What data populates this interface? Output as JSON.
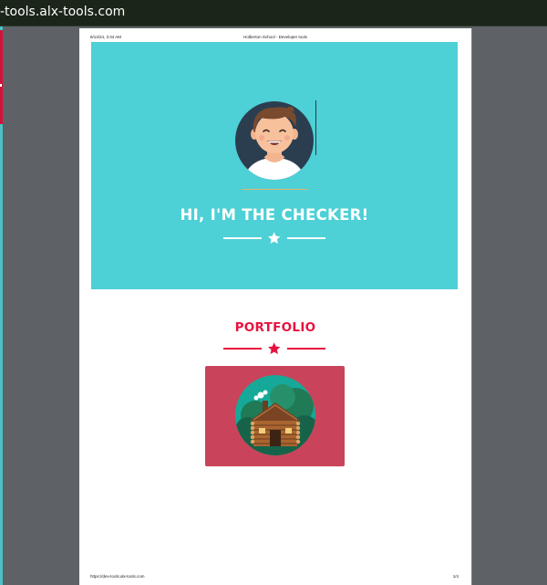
{
  "window": {
    "title": "-tools.alx-tools.com"
  },
  "print": {
    "header_left": "8/14/24, 3:34 AM",
    "header_center": "Holberton School - Developer tools",
    "footer_left": "https://dev-tools.alx-tools.com",
    "footer_right": "1/4"
  },
  "hero": {
    "title": "HI, I'M THE CHECKER!",
    "background_color": "#4dd0d6",
    "divider_icon": "star-icon"
  },
  "portfolio": {
    "title": "PORTFOLIO",
    "accent_color": "#e8123e",
    "divider_icon": "star-icon",
    "card_color": "#c9445a",
    "card_image": "log-cabin-illustration"
  }
}
